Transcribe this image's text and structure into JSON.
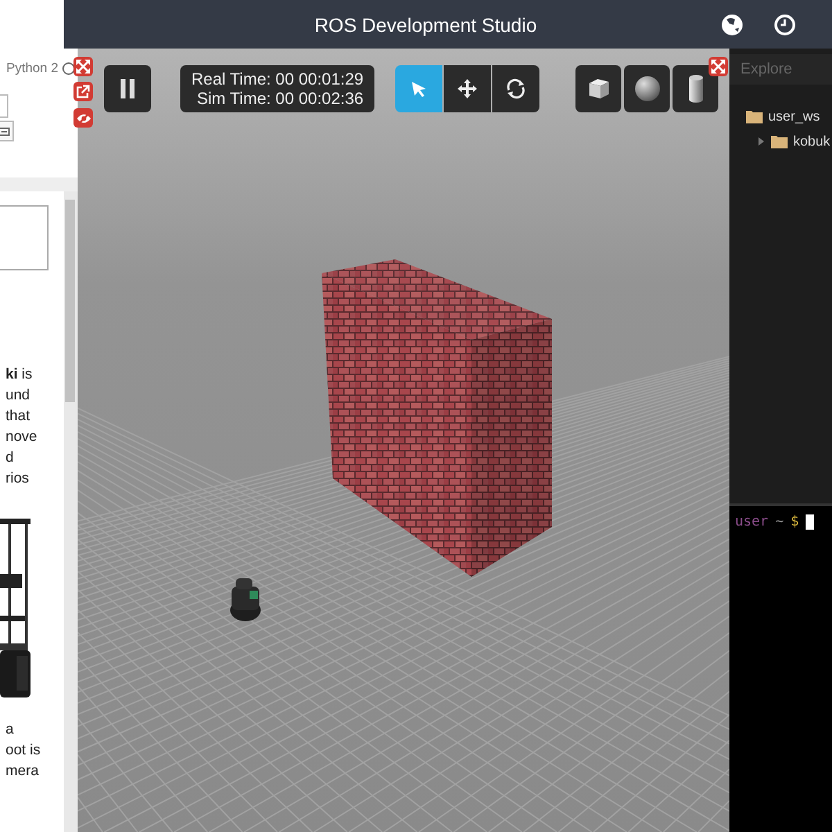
{
  "app": {
    "title": "ROS Development Studio"
  },
  "notebook": {
    "kernel": "Python 2",
    "text_lines": [
      "**ki** is",
      "und",
      "that",
      "nove",
      "d",
      "rios"
    ],
    "caption_lines": [
      "a",
      "oot is",
      "mera"
    ]
  },
  "simulation": {
    "paused": false,
    "real_time": "Real Time: 00 00:01:29",
    "sim_time": "Sim Time: 00 00:02:36",
    "tools": [
      {
        "kind": "select",
        "selected": true
      },
      {
        "kind": "translate",
        "selected": false
      },
      {
        "kind": "rotate",
        "selected": false
      }
    ],
    "shapes": [
      {
        "kind": "box"
      },
      {
        "kind": "sphere"
      },
      {
        "kind": "cylinder"
      }
    ]
  },
  "explorer": {
    "title": "Explore",
    "tree": [
      {
        "label": "user_ws",
        "children": [
          {
            "label": "kobuk",
            "expanded": false
          }
        ]
      }
    ]
  },
  "terminal": {
    "user": "user",
    "path": "~",
    "prompt": "$"
  }
}
